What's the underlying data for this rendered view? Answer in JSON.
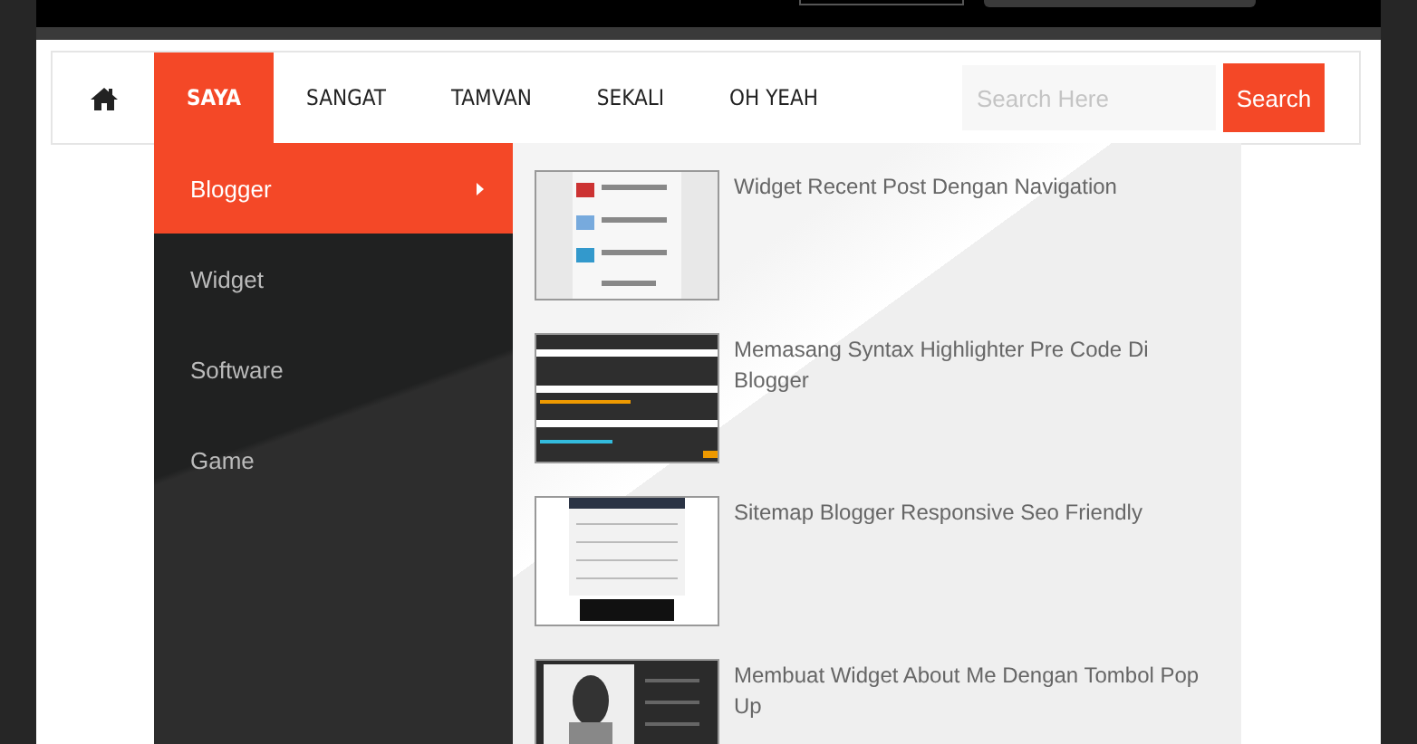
{
  "nav": {
    "items": [
      {
        "kind": "home",
        "selected": false
      },
      {
        "kind": "link",
        "label": "SAYA",
        "selected": true
      },
      {
        "kind": "link",
        "label": "SANGAT",
        "selected": false
      },
      {
        "kind": "link",
        "label": "TAMVAN",
        "selected": false
      },
      {
        "kind": "link",
        "label": "SEKALI",
        "selected": false
      },
      {
        "kind": "link",
        "label": "OH YEAH",
        "selected": false
      }
    ]
  },
  "search": {
    "placeholder": "Search Here",
    "button": "Search"
  },
  "dropdown": {
    "categories": [
      {
        "label": "Blogger",
        "selected": true,
        "has_submenu": true
      },
      {
        "label": "Widget",
        "selected": false,
        "has_submenu": false
      },
      {
        "label": "Software",
        "selected": false,
        "has_submenu": false
      },
      {
        "label": "Game",
        "selected": false,
        "has_submenu": false
      }
    ],
    "posts": [
      {
        "title": "Widget Recent Post Dengan Navigation",
        "kind": "picture"
      },
      {
        "title": "Memasang Syntax Highlighter Pre Code Di Blogger",
        "kind": "picture"
      },
      {
        "title": "Sitemap Blogger Responsive Seo Friendly",
        "kind": "picture"
      },
      {
        "title": "Membuat Widget About Me Dengan Tombol Pop Up",
        "kind": "picture"
      }
    ]
  }
}
